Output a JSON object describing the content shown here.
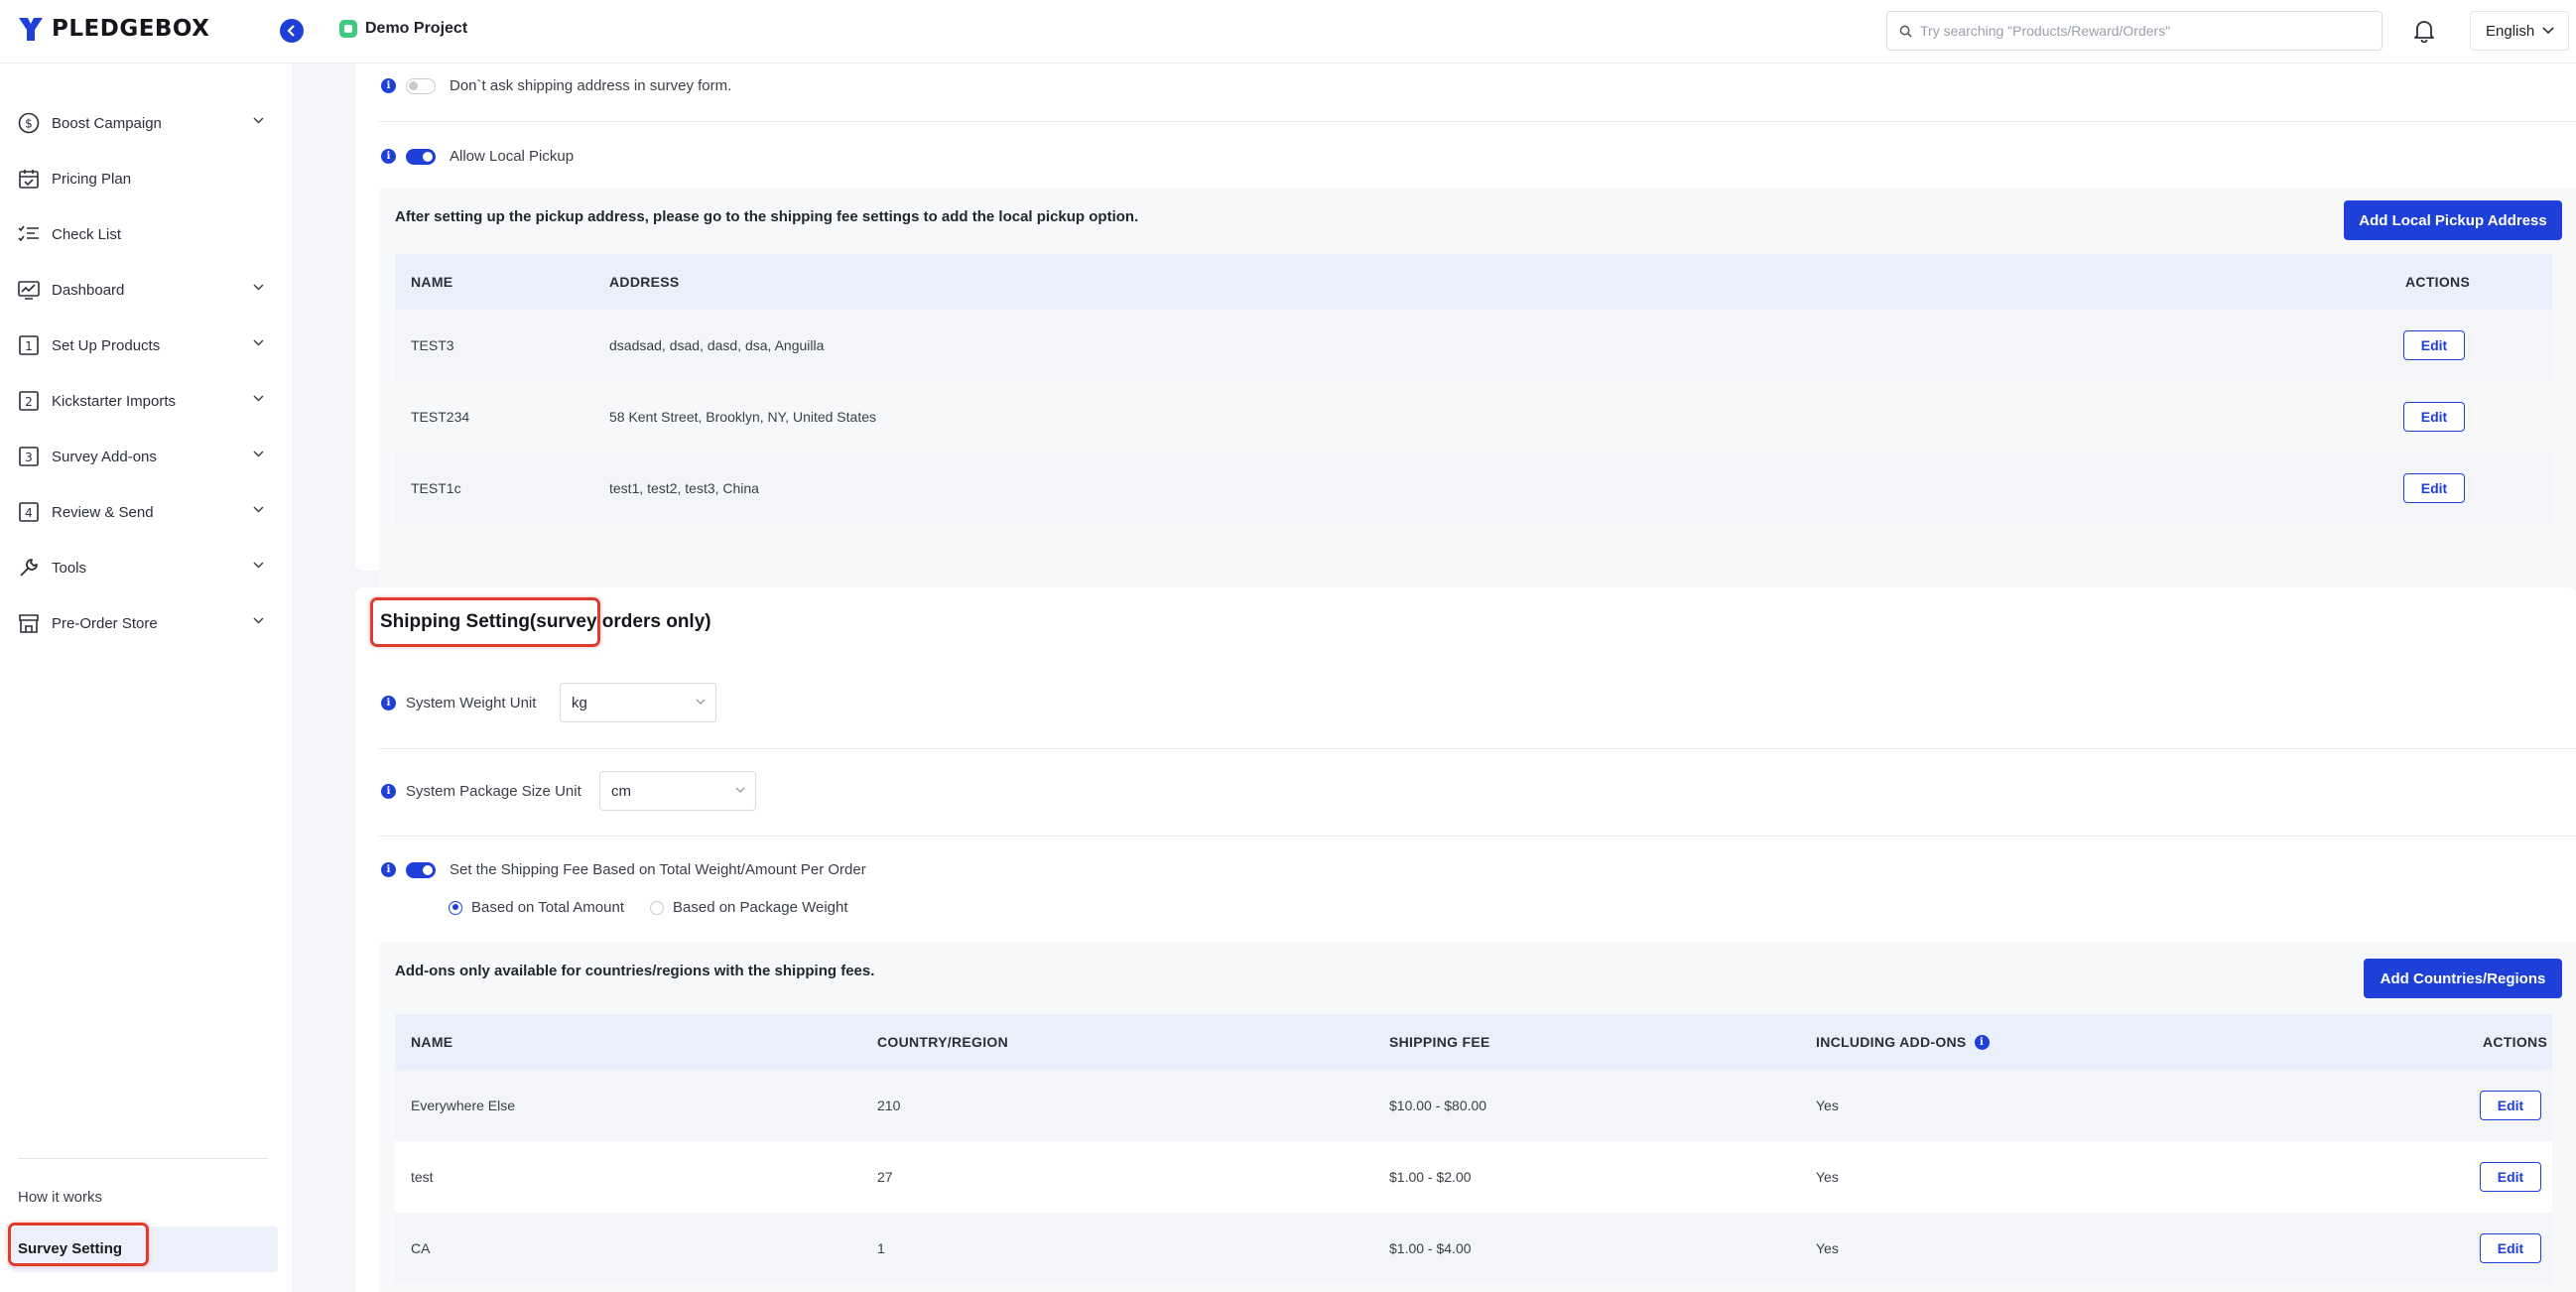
{
  "brand": {
    "name": "PLEDGEBOX",
    "accent": "#1e40d8"
  },
  "header": {
    "project_name": "Demo Project",
    "search_placeholder": "Try searching \"Products/Reward/Orders\"",
    "language": "English"
  },
  "sidebar": {
    "items": [
      {
        "label": "Boost Campaign",
        "icon": "dollar-circle-icon",
        "expandable": true
      },
      {
        "label": "Pricing Plan",
        "icon": "calendar-icon",
        "expandable": false
      },
      {
        "label": "Check List",
        "icon": "checklist-icon",
        "expandable": false
      },
      {
        "label": "Dashboard",
        "icon": "chart-icon",
        "expandable": true
      },
      {
        "label": "Set Up Products",
        "icon": "step-1-icon",
        "expandable": true
      },
      {
        "label": "Kickstarter Imports",
        "icon": "step-2-icon",
        "expandable": true
      },
      {
        "label": "Survey Add-ons",
        "icon": "step-3-icon",
        "expandable": true
      },
      {
        "label": "Review & Send",
        "icon": "step-4-icon",
        "expandable": true
      },
      {
        "label": "Tools",
        "icon": "wrench-icon",
        "expandable": true
      },
      {
        "label": "Pre-Order Store",
        "icon": "store-icon",
        "expandable": true
      }
    ],
    "how_it_works": "How it works",
    "active": "Survey Setting"
  },
  "pickup": {
    "dont_ask_label": "Don`t ask shipping address in survey form.",
    "dont_ask_on": false,
    "allow_local_label": "Allow Local Pickup",
    "allow_local_on": true,
    "note": "After setting up the pickup address, please go to the shipping fee settings to add the local pickup option.",
    "add_button": "Add Local Pickup Address",
    "columns": {
      "name": "NAME",
      "address": "ADDRESS",
      "actions": "ACTIONS"
    },
    "rows": [
      {
        "name": "TEST3",
        "address": "dsadsad, dsad, dasd, dsa, Anguilla",
        "action": "Edit"
      },
      {
        "name": "TEST234",
        "address": "58 Kent Street, Brooklyn, NY, United States",
        "action": "Edit"
      },
      {
        "name": "TEST1c",
        "address": "test1, test2, test3, China",
        "action": "Edit"
      }
    ]
  },
  "shipping": {
    "title": "Shipping Setting(survey orders only)",
    "weight_unit_label": "System Weight Unit",
    "weight_unit_value": "kg",
    "package_unit_label": "System Package Size Unit",
    "package_unit_value": "cm",
    "fee_based_label": "Set the Shipping Fee Based on Total Weight/Amount Per Order",
    "fee_based_on": true,
    "option_amount": "Based on Total Amount",
    "option_weight": "Based on Package Weight",
    "selected_option": "Based on Total Amount",
    "note": "Add-ons only available for countries/regions with the shipping fees.",
    "add_button": "Add Countries/Regions",
    "columns": {
      "name": "NAME",
      "country": "COUNTRY/REGION",
      "fee": "SHIPPING FEE",
      "addons": "INCLUDING ADD-ONS",
      "actions": "ACTIONS"
    },
    "rows": [
      {
        "name": "Everywhere Else",
        "country": "210",
        "fee": "$10.00 - $80.00",
        "addons": "Yes",
        "action": "Edit"
      },
      {
        "name": "test",
        "country": "27",
        "fee": "$1.00 - $2.00",
        "addons": "Yes",
        "action": "Edit"
      },
      {
        "name": "CA",
        "country": "1",
        "fee": "$1.00 - $4.00",
        "addons": "Yes",
        "action": "Edit"
      }
    ]
  }
}
